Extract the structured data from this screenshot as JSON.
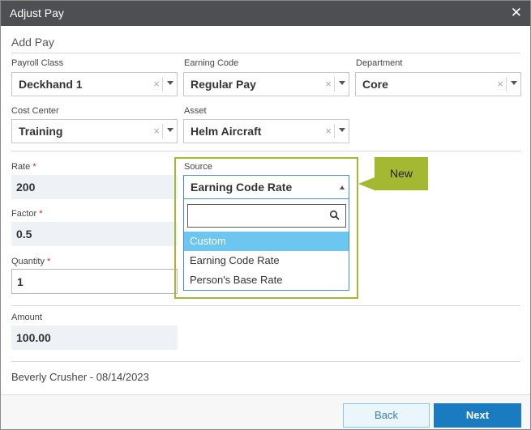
{
  "window": {
    "title": "Adjust Pay",
    "close_glyph": "✕"
  },
  "section": {
    "title": "Add Pay"
  },
  "fields": {
    "payroll_class": {
      "label": "Payroll Class",
      "value": "Deckhand 1"
    },
    "earning_code": {
      "label": "Earning Code",
      "value": "Regular Pay"
    },
    "department": {
      "label": "Department",
      "value": "Core"
    },
    "cost_center": {
      "label": "Cost Center",
      "value": "Training"
    },
    "asset": {
      "label": "Asset",
      "value": "Helm Aircraft"
    },
    "rate": {
      "label": "Rate",
      "required": "*",
      "value": "200"
    },
    "factor": {
      "label": "Factor",
      "required": "*",
      "value": "0.5"
    },
    "quantity": {
      "label": "Quantity",
      "required": "*",
      "value": "1"
    },
    "amount": {
      "label": "Amount",
      "value": "100.00"
    },
    "source": {
      "label": "Source",
      "value": "Earning Code Rate",
      "options": [
        "Custom",
        "Earning Code Rate",
        "Person's Base Rate"
      ],
      "highlighted_option": "Custom"
    }
  },
  "clear_glyph": "×",
  "callout": {
    "text": "New",
    "color": "#a5b832"
  },
  "footer": {
    "audit_text": "Beverly Crusher - 08/14/2023"
  },
  "buttons": {
    "back": "Back",
    "next": "Next"
  },
  "colors": {
    "titlebar": "#4d4f53",
    "primary": "#1a7bc1",
    "highlight": "#6cc6ef"
  }
}
